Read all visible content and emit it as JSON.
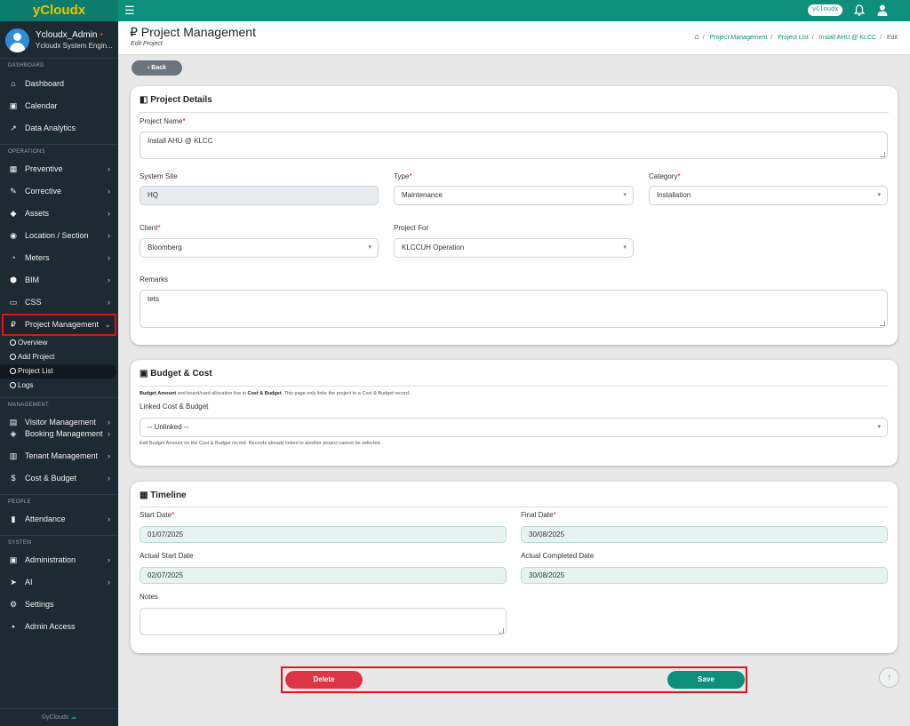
{
  "brand": "yCloudx",
  "topbar": {
    "user_pill": "yCloudx"
  },
  "profile": {
    "name": "Ycloudx_Admin",
    "role": "Ycloudx System Engin..."
  },
  "sidebar": {
    "sections": {
      "dashboard": "DASHBOARD",
      "operations": "OPERATIONS",
      "management": "MANAGEMENT",
      "people": "PEOPLE",
      "system": "SYSTEM"
    },
    "items": {
      "dashboard": "Dashboard",
      "calendar": "Calendar",
      "data_analytics": "Data Analytics",
      "preventive": "Preventive",
      "corrective": "Corrective",
      "assets": "Assets",
      "location": "Location / Section",
      "meters": "Meters",
      "bim": "BIM",
      "css": "CSS",
      "project_management": "Project Management",
      "visitor_management": "Visitor Management",
      "booking_management": "Booking Management",
      "tenant_management": "Tenant Management",
      "cost_budget": "Cost & Budget",
      "attendance": "Attendance",
      "administration": "Administration",
      "ai": "AI",
      "settings": "Settings",
      "admin_access": "Admin Access"
    },
    "subitems": {
      "overview": "Overview",
      "add_project": "Add Project",
      "project_list": "Project List",
      "logs": "Logs"
    },
    "footer": "©yCloudx"
  },
  "header": {
    "title": "Project Management",
    "subtitle": "Edit Project",
    "breadcrumb": [
      "Project Management",
      "Project List",
      "Install AHU @ KLCC",
      "Edit"
    ]
  },
  "back_label": "Back",
  "project_details": {
    "title": "Project Details",
    "project_name_label": "Project Name",
    "project_name": "Install AHU @ KLCC",
    "system_site_label": "System Site",
    "system_site": "HQ",
    "type_label": "Type",
    "type": "Maintenance",
    "category_label": "Category",
    "category": "Installation",
    "client_label": "Client",
    "client": "Bloomberg",
    "project_for_label": "Project For",
    "project_for": "KLCCUH Operation",
    "remarks_label": "Remarks",
    "remarks": "tets"
  },
  "budget": {
    "title": "Budget & Cost",
    "note_b1": "Budget Amount",
    "note_mid": " and board/card allocation live in ",
    "note_b2": "Cost & Budget",
    "note_end": ". This page only links the project to a Cost & Budget record.",
    "linked_label": "Linked Cost & Budget",
    "linked_value": "-- Unlinked --",
    "help": "Edit Budget Amount on the Cost & Budget record. Records already linked to another project cannot be selected."
  },
  "timeline": {
    "title": "Timeline",
    "start_label": "Start Date",
    "start": "01/07/2025",
    "final_label": "Final Date",
    "final": "30/08/2025",
    "actual_start_label": "Actual Start Date",
    "actual_start": "02/07/2025",
    "actual_completed_label": "Actual Completed Date",
    "actual_completed": "30/08/2025",
    "notes_label": "Notes",
    "notes": ""
  },
  "actions": {
    "delete": "Delete",
    "save": "Save"
  },
  "colors": {
    "teal": "#0e8f7b",
    "sidebar": "#1e2a32",
    "brand_yellow": "#f2c000",
    "danger": "#dc3545",
    "highlight_red": "#e0131b"
  }
}
